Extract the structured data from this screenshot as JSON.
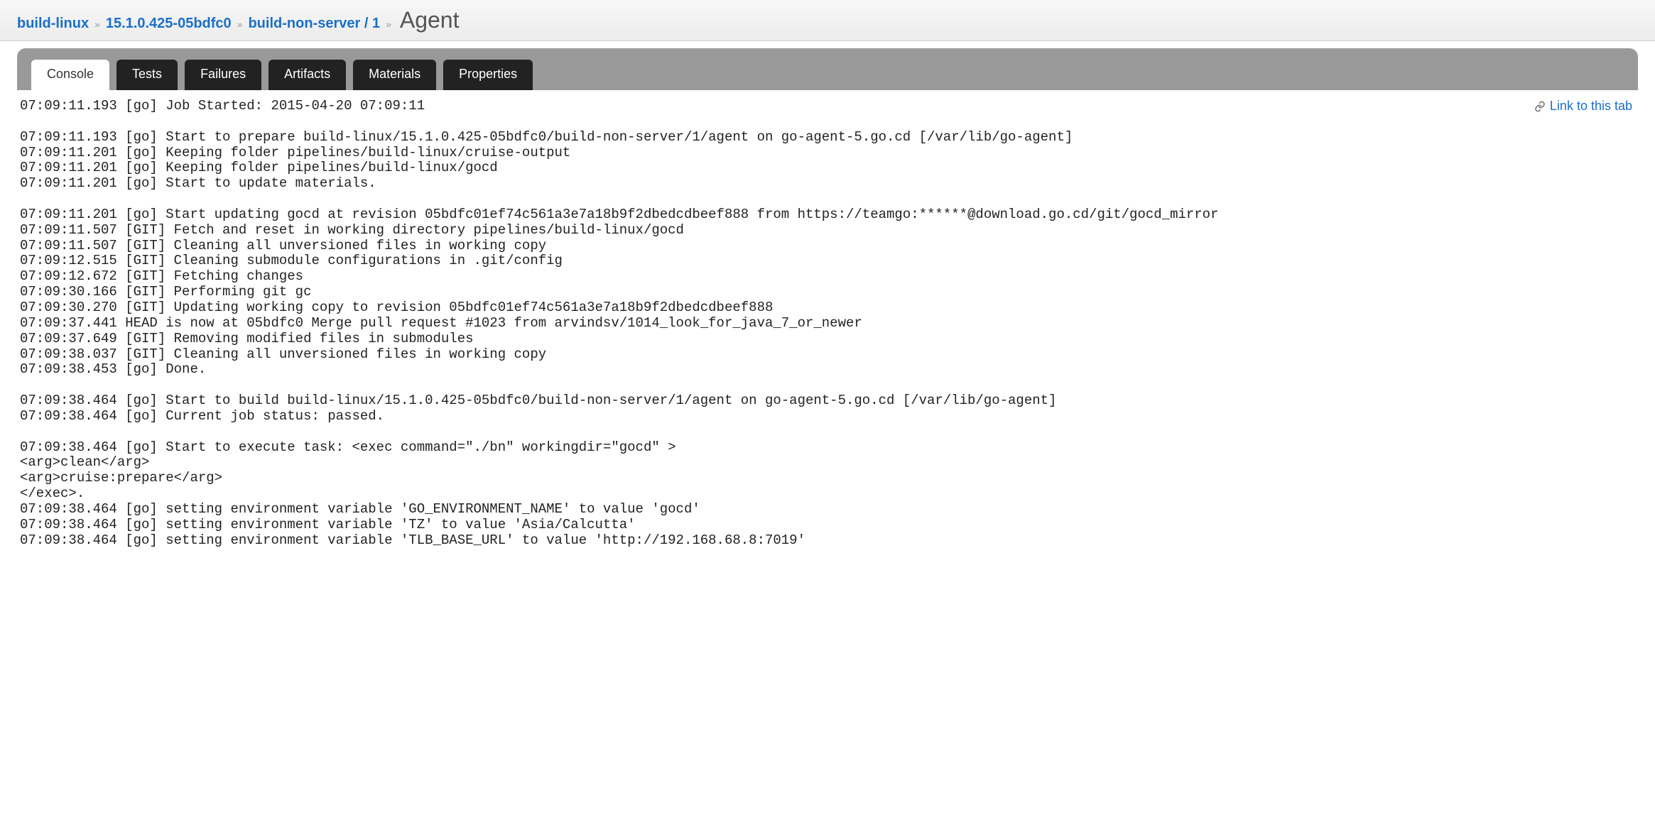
{
  "breadcrumb": {
    "items": [
      {
        "label": "build-linux"
      },
      {
        "label": "15.1.0.425-05bdfc0"
      },
      {
        "label": "build-non-server / 1"
      }
    ],
    "current": "Agent",
    "sep": "»"
  },
  "tabs": {
    "console": "Console",
    "tests": "Tests",
    "failures": "Failures",
    "artifacts": "Artifacts",
    "materials": "Materials",
    "properties": "Properties"
  },
  "link_to_tab": "Link to this tab",
  "console_lines": [
    "07:09:11.193 [go] Job Started: 2015-04-20 07:09:11",
    "",
    "07:09:11.193 [go] Start to prepare build-linux/15.1.0.425-05bdfc0/build-non-server/1/agent on go-agent-5.go.cd [/var/lib/go-agent]",
    "07:09:11.201 [go] Keeping folder pipelines/build-linux/cruise-output",
    "07:09:11.201 [go] Keeping folder pipelines/build-linux/gocd",
    "07:09:11.201 [go] Start to update materials.",
    "",
    "07:09:11.201 [go] Start updating gocd at revision 05bdfc01ef74c561a3e7a18b9f2dbedcdbeef888 from https://teamgo:******@download.go.cd/git/gocd_mirror",
    "07:09:11.507 [GIT] Fetch and reset in working directory pipelines/build-linux/gocd",
    "07:09:11.507 [GIT] Cleaning all unversioned files in working copy",
    "07:09:12.515 [GIT] Cleaning submodule configurations in .git/config",
    "07:09:12.672 [GIT] Fetching changes",
    "07:09:30.166 [GIT] Performing git gc",
    "07:09:30.270 [GIT] Updating working copy to revision 05bdfc01ef74c561a3e7a18b9f2dbedcdbeef888",
    "07:09:37.441 HEAD is now at 05bdfc0 Merge pull request #1023 from arvindsv/1014_look_for_java_7_or_newer",
    "07:09:37.649 [GIT] Removing modified files in submodules",
    "07:09:38.037 [GIT] Cleaning all unversioned files in working copy",
    "07:09:38.453 [go] Done.",
    "",
    "07:09:38.464 [go] Start to build build-linux/15.1.0.425-05bdfc0/build-non-server/1/agent on go-agent-5.go.cd [/var/lib/go-agent]",
    "07:09:38.464 [go] Current job status: passed.",
    "",
    "07:09:38.464 [go] Start to execute task: <exec command=\"./bn\" workingdir=\"gocd\" >",
    "<arg>clean</arg>",
    "<arg>cruise:prepare</arg>",
    "</exec>.",
    "07:09:38.464 [go] setting environment variable 'GO_ENVIRONMENT_NAME' to value 'gocd'",
    "07:09:38.464 [go] setting environment variable 'TZ' to value 'Asia/Calcutta'",
    "07:09:38.464 [go] setting environment variable 'TLB_BASE_URL' to value 'http://192.168.68.8:7019'"
  ]
}
